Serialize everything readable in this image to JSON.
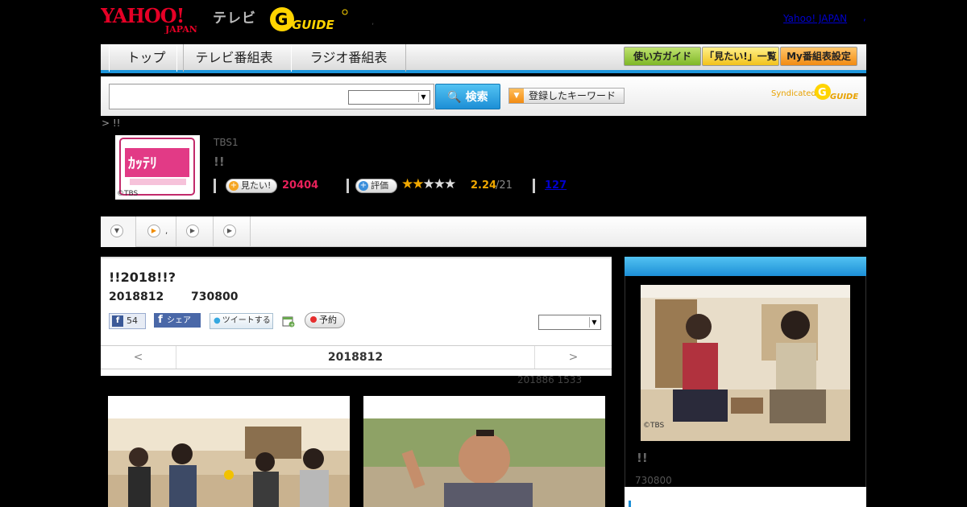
{
  "header": {
    "yahoo_logo": "YAHOO! JAPAN",
    "tv_label": "テレビ",
    "gguide_logo": "G-GUIDE",
    "yahoo_japan_link": "Yahoo! JAPAN",
    "link_sep": ",",
    "small_dot": ","
  },
  "nav": {
    "tabs": [
      {
        "label": "トップ"
      },
      {
        "label": "テレビ番組表"
      },
      {
        "label": "ラジオ番組表"
      }
    ],
    "buttons": [
      {
        "label": "使い方ガイド"
      },
      {
        "label": "「見たい!」一覧"
      },
      {
        "label": "My番組表設定"
      }
    ]
  },
  "search": {
    "placeholder": "",
    "button_label": "検索",
    "keyword_button": "登録したキーワード",
    "syndicated": "Syndicated"
  },
  "breadcrumb": "> !!",
  "program": {
    "thumb_copyright": "©TBS",
    "channel": "TBS1",
    "title": "!!",
    "want_label": "見たい!",
    "want_count": "20404",
    "rate_label": "評価",
    "rating": "2.24",
    "rating_of": "/21",
    "stars_filled": 2,
    "stars_total": 5,
    "review_count": "127"
  },
  "subtabs": {
    "dot": ","
  },
  "episode": {
    "title": "!!2018!!?",
    "date": "2018812",
    "time": "730800",
    "fb_like_count": "54",
    "fb_share": "シェア",
    "tweet": "ツイートする",
    "reserve": "予約",
    "prev": "<",
    "current_date": "2018812",
    "next": ">"
  },
  "update_note": "201886  1533",
  "side": {
    "photo_copyright": "©TBS",
    "title": "!!",
    "time": "730800"
  },
  "colors": {
    "accent_blue": "#1e96dc",
    "want_pink": "#e8205a",
    "star_gold": "#f0a800",
    "link_blue": "#0000cc"
  }
}
